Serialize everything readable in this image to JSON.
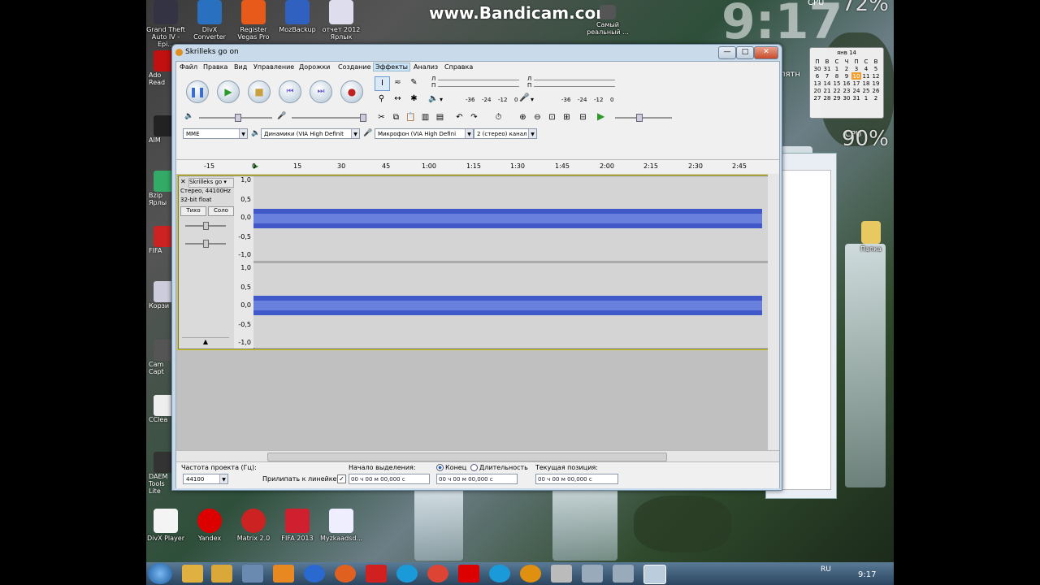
{
  "watermark": "www.Bandicam.com",
  "desktop": {
    "clock_big": "9:17",
    "top_icons": [
      {
        "label": "Grand Theft Auto IV - Epi...",
        "color": "#334"
      },
      {
        "label": "DivX Converter",
        "color": "#2a70c0"
      },
      {
        "label": "Register Vegas Pro",
        "color": "#e85a1a"
      },
      {
        "label": "MozBackup",
        "color": "#3060c0"
      },
      {
        "label": "отчет 2012 Ярлык",
        "color": "#dde"
      }
    ],
    "left_icons": [
      {
        "label": "Ado Read",
        "color": "#c01010"
      },
      {
        "label": "AIM",
        "color": "#222"
      },
      {
        "label": "Bzip Ярлы",
        "color": "#3a6"
      },
      {
        "label": "FIFA",
        "color": "#c22"
      },
      {
        "label": "Корзи",
        "color": "#ccd"
      },
      {
        "label": "Cam Capt",
        "color": "#555"
      },
      {
        "label": "CClea",
        "color": "#eee"
      },
      {
        "label": "DAEM Tools Lite",
        "color": "#333"
      }
    ],
    "bottom_icons": [
      {
        "label": "DivX Player",
        "color": "#f4f4f4"
      },
      {
        "label": "Yandex",
        "color": "#d00"
      },
      {
        "label": "Matrix 2.0",
        "color": "#c22"
      },
      {
        "label": "FIFA 2013",
        "color": "#d02030"
      },
      {
        "label": "Myzkaadsd...",
        "color": "#eef"
      }
    ],
    "right_icons": [
      {
        "label": "Самый реальный ..."
      },
      {
        "label": "Папка"
      }
    ],
    "calendar": {
      "header": "янв 14",
      "days": [
        "П",
        "В",
        "С",
        "Ч",
        "П",
        "С",
        "В"
      ],
      "weeks": [
        [
          "30",
          "31",
          "1",
          "2",
          "3",
          "4",
          "5"
        ],
        [
          "6",
          "7",
          "8",
          "9",
          "10",
          "11",
          "12"
        ],
        [
          "13",
          "14",
          "15",
          "16",
          "17",
          "18",
          "19"
        ],
        [
          "20",
          "21",
          "22",
          "23",
          "24",
          "25",
          "26"
        ],
        [
          "27",
          "28",
          "29",
          "30",
          "31",
          "1",
          "2"
        ]
      ],
      "today": "10"
    },
    "cpu1_label": "CPU",
    "cpu1_value": "72%",
    "cpu2_label": "CPU",
    "cpu2_value": "90%",
    "side_text": "пятн"
  },
  "window": {
    "title": "Skrilleks go on",
    "minimize": "—",
    "maximize": "□",
    "close": "✕",
    "menu": [
      "Файл",
      "Правка",
      "Вид",
      "Управление",
      "Дорожки",
      "Создание",
      "Эффекты",
      "Анализ",
      "Справка"
    ],
    "selected_menu": "Эффекты",
    "transport": {
      "pause": "❚❚",
      "play": "▶",
      "stop": "■",
      "skip_start": "⏮",
      "skip_end": "⏭",
      "record": "●"
    },
    "meter_marks_top": [
      "Л",
      "П"
    ],
    "meter_numbers_play": [
      "-36",
      "-24",
      "-12",
      "0"
    ],
    "meter_numbers_rec": [
      "-36",
      "-24",
      "-12",
      "0"
    ],
    "device": {
      "host": "MME",
      "output": "Динамики (VIA High Definit",
      "input": "Микрофон (VIA High Defini",
      "channels": "2 (стерео) канал"
    },
    "ruler": [
      "-15",
      "0",
      "15",
      "30",
      "45",
      "1:00",
      "1:15",
      "1:30",
      "1:45",
      "2:00",
      "2:15",
      "2:30",
      "2:45"
    ],
    "track": {
      "name": "Skrilleks go",
      "info1": "Стерео, 44100Hz",
      "info2": "32-bit float",
      "mute": "Тихо",
      "solo": "Соло",
      "vscale": [
        "1,0",
        "0,5",
        "0,0",
        "-0,5",
        "-1,0"
      ]
    },
    "selection": {
      "rate_label": "Частота проекта (Гц):",
      "rate_value": "44100",
      "snap_label": "Прилипать к линейке",
      "start_label": "Начало выделения:",
      "end_label": "Конец",
      "length_label": "Длительность",
      "pos_label": "Текущая позиция:",
      "time1": "00 ч 00 м 00,000 с",
      "time2": "00 ч 00 м 00,000 с",
      "time3": "00 ч 00 м 00,000 с"
    }
  },
  "taskbar": {
    "lang": "RU",
    "time": "9:17"
  }
}
